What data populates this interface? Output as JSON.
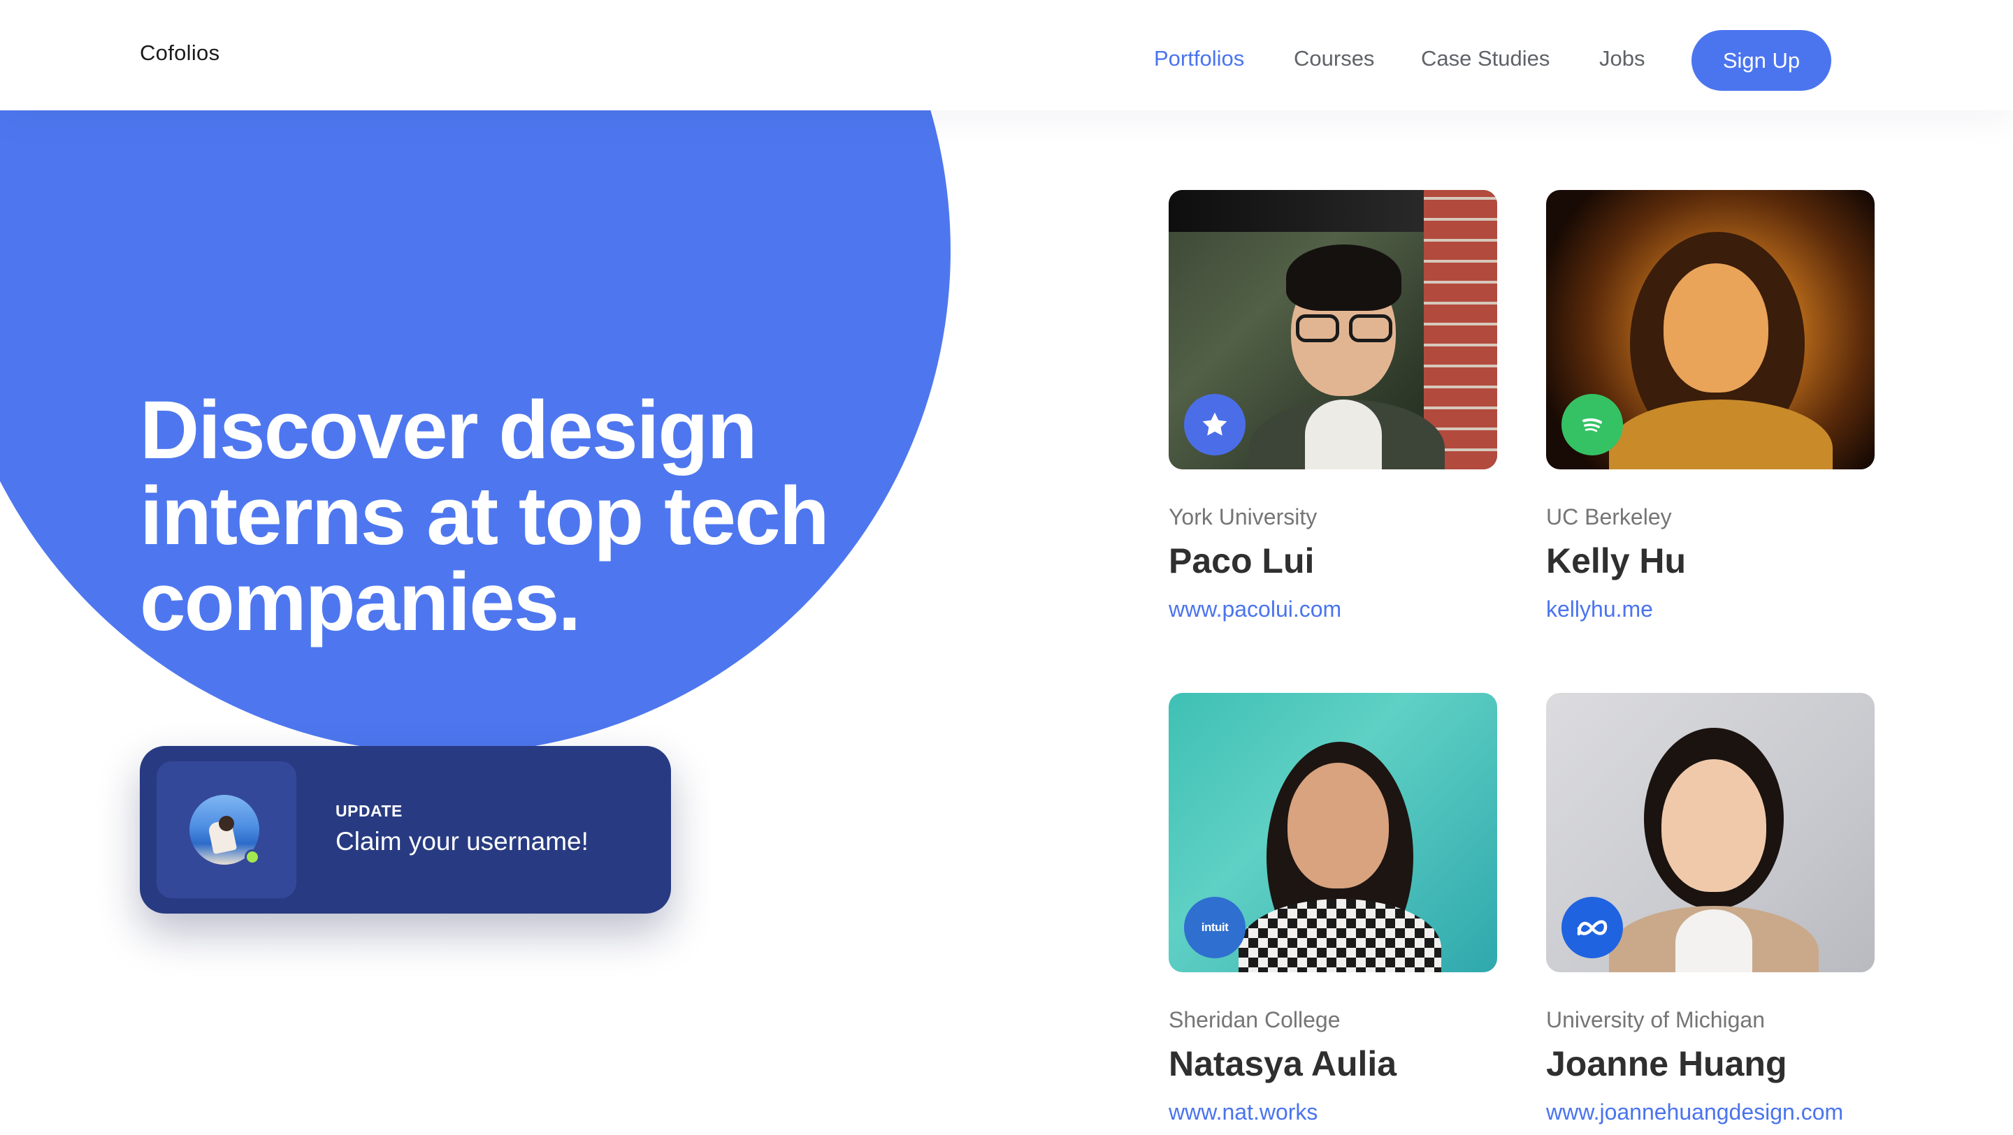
{
  "header": {
    "logo": "Cofolios",
    "nav": [
      {
        "label": "Portfolios",
        "active": true
      },
      {
        "label": "Courses",
        "active": false
      },
      {
        "label": "Case Studies",
        "active": false
      },
      {
        "label": "Jobs",
        "active": false
      }
    ],
    "signup_label": "Sign Up"
  },
  "hero": {
    "title_line1": "Discover design",
    "title_line2": "interns at top tech",
    "title_line3": "companies."
  },
  "update_card": {
    "label": "UPDATE",
    "text": "Claim your username!"
  },
  "portfolios": [
    {
      "school": "York University",
      "name": "Paco Lui",
      "link": "www.pacolui.com",
      "badge_icon": "star-icon",
      "badge_color": "#4b6ee8"
    },
    {
      "school": "UC Berkeley",
      "name": "Kelly Hu",
      "link": "kellyhu.me",
      "badge_icon": "spotify-icon",
      "badge_color": "#35c264"
    },
    {
      "school": "Sheridan College",
      "name": "Natasya Aulia",
      "link": "www.nat.works",
      "badge_icon": "intuit-icon",
      "badge_label": "intuit",
      "badge_color": "#2f6fd0"
    },
    {
      "school": "University of Michigan",
      "name": "Joanne Huang",
      "link": "www.joannehuangdesign.com",
      "badge_icon": "meta-icon",
      "badge_color": "#1f63e0"
    }
  ],
  "colors": {
    "accent": "#4b75ef",
    "hero_blue": "#4e77ef",
    "update_card": "#283b82",
    "link": "#4a74ee",
    "online": "#a3e84f"
  }
}
